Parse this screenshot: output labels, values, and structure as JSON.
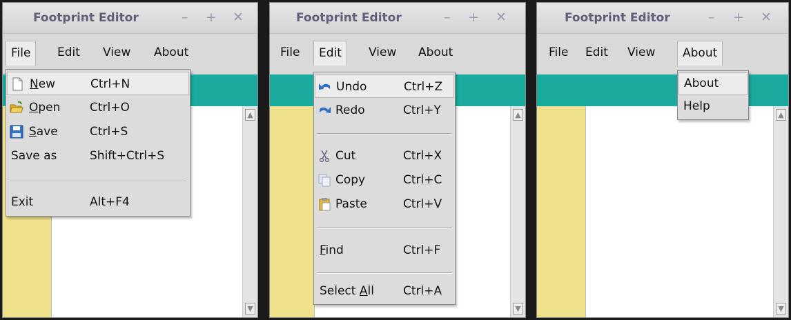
{
  "window_title": "Footprint Editor",
  "title_buttons": {
    "minimize": "–",
    "maximize": "+",
    "close": "✕"
  },
  "menubar": {
    "file": "File",
    "edit": "Edit",
    "view": "View",
    "about": "About"
  },
  "file_menu": [
    {
      "mnemonic": "N",
      "rest": "ew",
      "shortcut": "Ctrl+N",
      "icon": "new-document-icon"
    },
    {
      "mnemonic": "O",
      "rest": "pen",
      "shortcut": "Ctrl+O",
      "icon": "open-folder-icon"
    },
    {
      "mnemonic": "S",
      "rest": "ave",
      "shortcut": "Ctrl+S",
      "icon": "save-floppy-icon"
    },
    {
      "label": "Save as",
      "shortcut": "Shift+Ctrl+S"
    },
    {
      "label": "Exit",
      "shortcut": "Alt+F4"
    }
  ],
  "edit_menu": [
    {
      "label": "Undo",
      "shortcut": "Ctrl+Z",
      "icon": "undo-icon"
    },
    {
      "label": "Redo",
      "shortcut": "Ctrl+Y",
      "icon": "redo-icon"
    },
    {
      "label": "Cut",
      "shortcut": "Ctrl+X",
      "icon": "scissors-icon"
    },
    {
      "label": "Copy",
      "shortcut": "Ctrl+C",
      "icon": "copy-icon"
    },
    {
      "label": "Paste",
      "shortcut": "Ctrl+V",
      "icon": "paste-clipboard-icon"
    },
    {
      "mnemonic": "F",
      "rest": "ind",
      "shortcut": "Ctrl+F"
    },
    {
      "prefix": "Select ",
      "mnemonic": "A",
      "rest": "ll",
      "shortcut": "Ctrl+A"
    }
  ],
  "about_menu": [
    {
      "label": "About"
    },
    {
      "label": "Help"
    }
  ],
  "colors": {
    "ruler": "#1bab9e",
    "gutter": "#efe18c",
    "editor": "#ffffff",
    "title_text": "#5f5f7a"
  }
}
